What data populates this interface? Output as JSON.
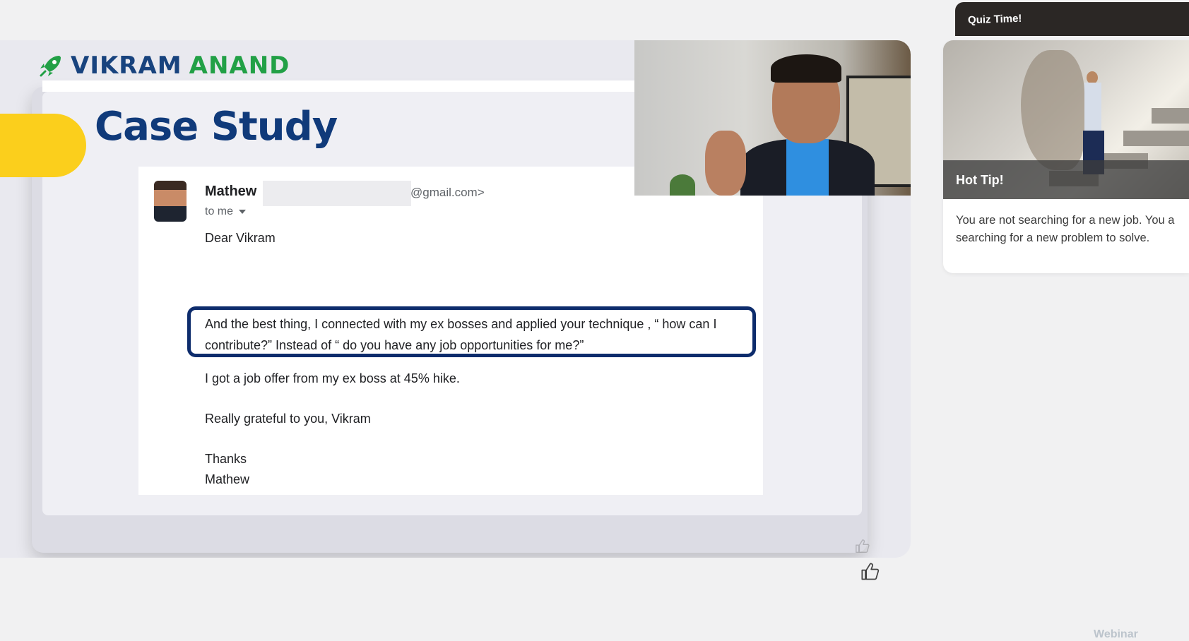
{
  "brand": {
    "first": "VIKRAM",
    "last": "ANAND"
  },
  "slide": {
    "title": "Case Study"
  },
  "email": {
    "sender_name": "Mathew",
    "sender_domain": "@gmail.com>",
    "recipient": "to me",
    "greeting": "Dear Vikram",
    "highlight": "And the best thing, I connected with my ex bosses and applied your technique , “ how can I contribute?” Instead of  “ do you have any job opportunities for me?”",
    "line_offer": "I got a job offer from my ex boss at 45% hike.",
    "line_grateful": "Really grateful to you, Vikram",
    "signoff": "Thanks",
    "signature": "Mathew"
  },
  "sidebar": {
    "quiz_label": "Quiz Time!",
    "tip_label": "Hot Tip!",
    "tip_text": "You are not searching for a new job. You a\nsearching for a new problem to solve."
  },
  "footer": {
    "watermark": "Webinar"
  },
  "colors": {
    "brand_blue": "#18437e",
    "brand_green": "#22a046",
    "accent_yellow": "#fbcf1c",
    "title_navy": "#103a7a"
  },
  "icons": [
    "rocket-icon",
    "caret-down-icon",
    "thumbs-up-icon"
  ]
}
